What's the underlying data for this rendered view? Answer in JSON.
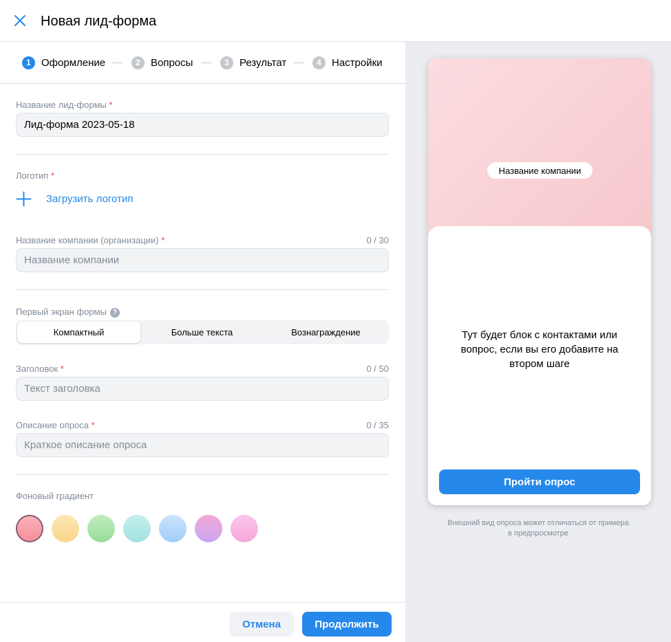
{
  "header": {
    "title": "Новая лид-форма"
  },
  "steps": [
    {
      "num": "1",
      "label": "Оформление"
    },
    {
      "num": "2",
      "label": "Вопросы"
    },
    {
      "num": "3",
      "label": "Результат"
    },
    {
      "num": "4",
      "label": "Настройки"
    }
  ],
  "form": {
    "form_name": {
      "label": "Название лид-формы",
      "required": "*",
      "value": "Лид-форма 2023-05-18"
    },
    "logo": {
      "label": "Логотип",
      "required": "*",
      "upload_label": "Загрузить логотип"
    },
    "company": {
      "label": "Название компании (организации)",
      "required": "*",
      "counter": "0 / 30",
      "placeholder": "Название компании"
    },
    "first_screen": {
      "label": "Первый экран формы",
      "help": "?",
      "options": [
        "Компактный",
        "Больше текста",
        "Вознаграждение"
      ],
      "selected": "Компактный"
    },
    "headline": {
      "label": "Заголовок",
      "required": "*",
      "counter": "0 / 50",
      "placeholder": "Текст заголовка"
    },
    "description": {
      "label": "Описание опроса",
      "required": "*",
      "counter": "0 / 35",
      "placeholder": "Краткое описание опроса"
    },
    "gradient": {
      "label": "Фоновый градиент",
      "selected_index": 0,
      "swatches": [
        {
          "from": "#f9b4b9",
          "to": "#f58f98"
        },
        {
          "from": "#fde8b4",
          "to": "#f9d58c"
        },
        {
          "from": "#c2ecc0",
          "to": "#96dc97"
        },
        {
          "from": "#c5efee",
          "to": "#a0e2e0"
        },
        {
          "from": "#c9e4fd",
          "to": "#a2cdf8"
        },
        {
          "from": "#f3a9d6",
          "to": "#c9a6f2"
        },
        {
          "from": "#fbc6ea",
          "to": "#f5a8dc"
        }
      ]
    }
  },
  "footer": {
    "cancel": "Отмена",
    "continue": "Продолжить"
  },
  "preview": {
    "company_name": "Название компании",
    "body_text": "Тут будет блок с контактами или вопрос, если вы его добавите на втором шаге",
    "button": "Пройти опрос",
    "note": "Внешний вид опроса может отличаться от примера в предпросмотре"
  },
  "colors": {
    "accent": "#2688eb",
    "required": "#e64646"
  },
  "icons": {
    "close": "close-icon",
    "plus": "plus-icon",
    "help": "help-icon"
  }
}
